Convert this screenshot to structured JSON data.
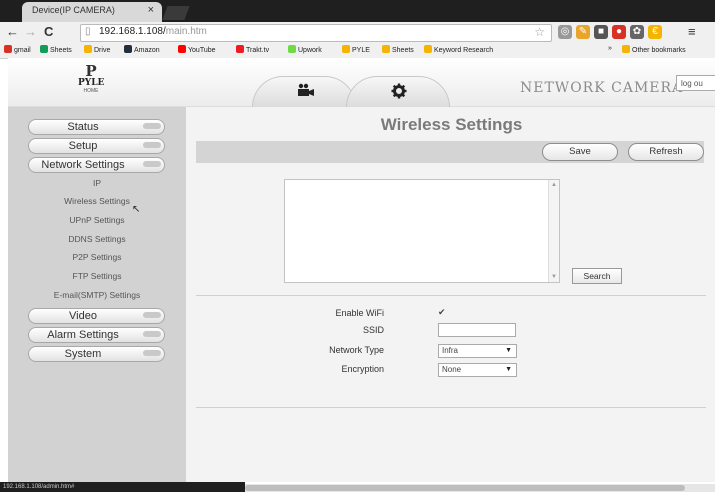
{
  "browser": {
    "tab_title": "Device(IP CAMERA)",
    "tab_close": "×",
    "url_host": "192.168.1.108/",
    "url_path": "main.htm",
    "bookmarks": [
      {
        "label": "gmail",
        "color": "#d93025"
      },
      {
        "label": "Sheets",
        "color": "#0f9d58"
      },
      {
        "label": "Drive",
        "color": "#f4b400"
      },
      {
        "label": "Amazon",
        "color": "#232f3e"
      },
      {
        "label": "YouTube",
        "color": "#ff0000"
      },
      {
        "label": "Trakt.tv",
        "color": "#ed1c24"
      },
      {
        "label": "Upwork",
        "color": "#6fda44"
      },
      {
        "label": "PYLE",
        "color": "#f4b400"
      },
      {
        "label": "Sheets",
        "color": "#f4b400"
      },
      {
        "label": "Keyword Research",
        "color": "#f4b400"
      }
    ],
    "other_bookmarks": "Other bookmarks",
    "status_url": "192.168.1.108/admin.htm#"
  },
  "header": {
    "logo_mark": "P",
    "logo_word": "PYLE",
    "logo_sub": "HOME",
    "brand": "NETWORK CAMERA",
    "logout": "log ou",
    "tab_icons": [
      "video-camera-icon",
      "gear-icon"
    ]
  },
  "sidebar": {
    "status": "Status",
    "setup": "Setup",
    "network_settings": "Network Settings",
    "sublinks": [
      "IP",
      "Wireless Settings",
      "UPnP Settings",
      "DDNS Settings",
      "P2P Settings",
      "FTP Settings",
      "E-mail(SMTP) Settings"
    ],
    "video": "Video",
    "alarm_settings": "Alarm Settings",
    "system": "System"
  },
  "main": {
    "title": "Wireless Settings",
    "save": "Save",
    "refresh": "Refresh",
    "search": "Search",
    "fields": {
      "enable_wifi_label": "Enable WiFi",
      "enable_wifi_checked": true,
      "ssid_label": "SSID",
      "ssid_value": "",
      "network_type_label": "Network Type",
      "network_type_value": "Infra",
      "encryption_label": "Encryption",
      "encryption_value": "None"
    }
  },
  "colors": {
    "sidebar_bg": "#d2d2d2",
    "title_color": "#7a7a7a",
    "brand_color": "#8c8c8c"
  }
}
